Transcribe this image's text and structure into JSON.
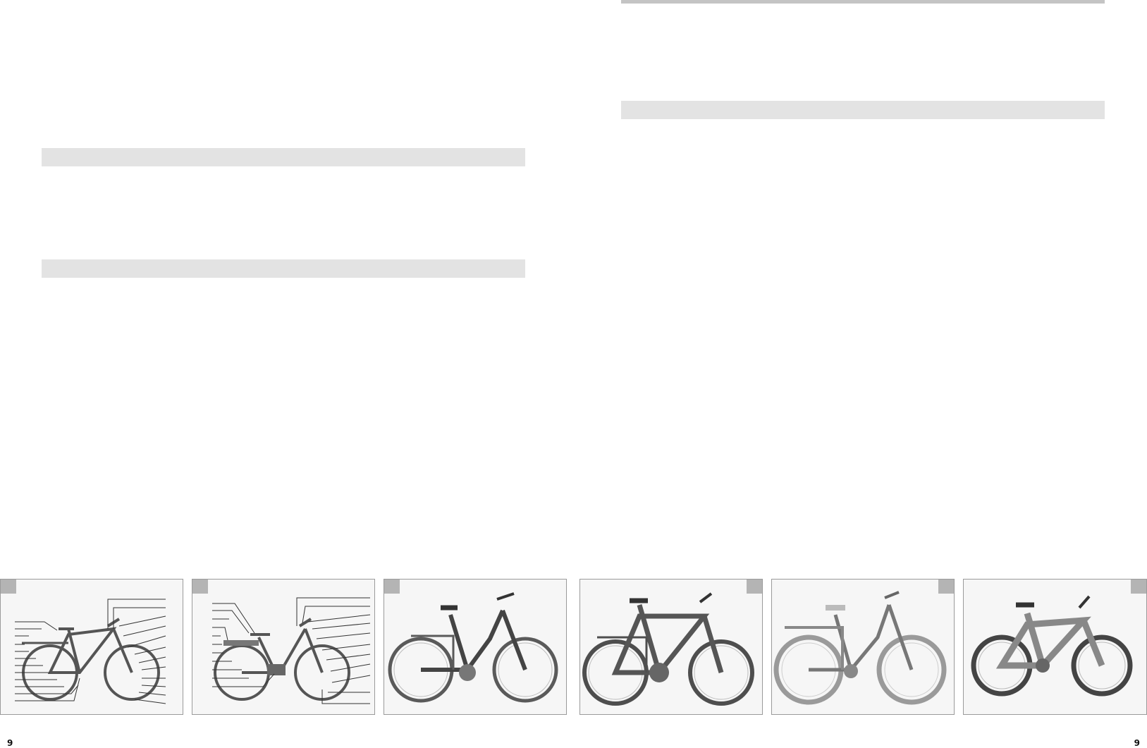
{
  "page": {
    "page_number_left": "9",
    "page_number_right": "9"
  },
  "figures": [
    {
      "name": "bike-diagram-trekking",
      "icon": "bicycle-diagram-icon"
    },
    {
      "name": "bike-diagram-ebike",
      "icon": "bicycle-diagram-icon"
    },
    {
      "name": "bike-photo-low-step",
      "icon": "bicycle-photo-icon"
    },
    {
      "name": "bike-photo-trekking-men",
      "icon": "bicycle-photo-icon"
    },
    {
      "name": "bike-photo-city-women",
      "icon": "bicycle-photo-icon"
    },
    {
      "name": "bike-photo-kids",
      "icon": "bicycle-photo-icon"
    }
  ],
  "colors": {
    "section_bar": "#e3e3e3",
    "top_rule": "#c4c4c4",
    "figure_tab": "#b4b4b4",
    "figure_border": "#9a9a9a"
  }
}
